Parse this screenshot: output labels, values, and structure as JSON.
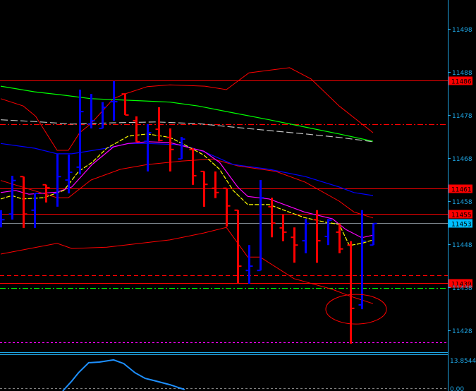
{
  "chart_data": [
    {
      "type": "bar",
      "subtype": "ohlc",
      "grid": false,
      "ylim": [
        11421,
        11505
      ],
      "y_ticks": [
        "11498",
        "11488",
        "11478",
        "11468",
        "11458",
        "11448",
        "11438",
        "11428"
      ],
      "colors": {
        "up": "#0000ff",
        "down": "#ff0000",
        "background": "#000000",
        "axis": "#1ea7e6"
      },
      "bars": [
        {
          "o": 11452.9,
          "h": 11455.9,
          "l": 11451.9,
          "c": 11453.7
        },
        {
          "o": 11455.0,
          "h": 11463.9,
          "l": 11453.7,
          "c": 11462.8
        },
        {
          "o": 11463.7,
          "h": 11463.7,
          "l": 11451.8,
          "c": 11455.0
        },
        {
          "o": 11455.9,
          "h": 11459.8,
          "l": 11451.8,
          "c": 11459.8
        },
        {
          "o": 11461.8,
          "h": 11461.8,
          "l": 11457.7,
          "c": 11461.1
        },
        {
          "o": 11459.8,
          "h": 11469.0,
          "l": 11456.7,
          "c": 11463.7
        },
        {
          "o": 11462.9,
          "h": 11468.8,
          "l": 11459.8,
          "c": 11464.7
        },
        {
          "o": 11465.9,
          "h": 11483.9,
          "l": 11464.2,
          "c": 11478.8
        },
        {
          "o": 11475.9,
          "h": 11482.9,
          "l": 11474.9,
          "c": 11476.7
        },
        {
          "o": 11474.9,
          "h": 11481.0,
          "l": 11474.9,
          "c": 11479.8
        },
        {
          "o": 11481.1,
          "h": 11485.9,
          "l": 11476.7,
          "c": 11481.1
        },
        {
          "o": 11482.9,
          "h": 11482.9,
          "l": 11478.0,
          "c": 11478.0
        },
        {
          "o": 11476.7,
          "h": 11477.7,
          "l": 11471.8,
          "c": 11471.8
        },
        {
          "o": 11471.9,
          "h": 11475.9,
          "l": 11464.9,
          "c": 11473.9
        },
        {
          "o": 11474.7,
          "h": 11479.8,
          "l": 11471.9,
          "c": 11472.1
        },
        {
          "o": 11472.8,
          "h": 11474.9,
          "l": 11464.9,
          "c": 11470.0
        },
        {
          "o": 11467.8,
          "h": 11472.9,
          "l": 11467.8,
          "c": 11472.4
        },
        {
          "o": 11470.0,
          "h": 11470.3,
          "l": 11461.8,
          "c": 11463.9
        },
        {
          "o": 11464.9,
          "h": 11464.9,
          "l": 11456.7,
          "c": 11461.9
        },
        {
          "o": 11461.0,
          "h": 11464.9,
          "l": 11458.7,
          "c": 11460.0
        },
        {
          "o": 11461.0,
          "h": 11461.0,
          "l": 11452.1,
          "c": 11456.9
        },
        {
          "o": 11455.9,
          "h": 11455.9,
          "l": 11438.8,
          "c": 11442.9
        },
        {
          "o": 11441.9,
          "h": 11447.8,
          "l": 11438.8,
          "c": 11442.9
        },
        {
          "o": 11441.9,
          "h": 11462.9,
          "l": 11441.9,
          "c": 11458.8
        },
        {
          "o": 11456.7,
          "h": 11458.8,
          "l": 11449.6,
          "c": 11452.9
        },
        {
          "o": 11451.8,
          "h": 11454.9,
          "l": 11448.7,
          "c": 11450.8
        },
        {
          "o": 11449.6,
          "h": 11451.9,
          "l": 11443.7,
          "c": 11447.8
        },
        {
          "o": 11448.8,
          "h": 11453.9,
          "l": 11445.9,
          "c": 11452.8
        },
        {
          "o": 11453.7,
          "h": 11455.9,
          "l": 11443.7,
          "c": 11448.8
        },
        {
          "o": 11449.8,
          "h": 11453.9,
          "l": 11447.8,
          "c": 11453.6
        },
        {
          "o": 11450.8,
          "h": 11452.8,
          "l": 11445.9,
          "c": 11446.9
        },
        {
          "o": 11447.8,
          "h": 11448.7,
          "l": 11424.9,
          "c": 11433.1
        },
        {
          "o": 11433.9,
          "h": 11455.9,
          "l": 11432.9,
          "c": 11448.7
        },
        {
          "o": 11447.8,
          "h": 11452.8,
          "l": 11447.8,
          "c": 11452.8
        }
      ],
      "lines": [
        {
          "color": "#ff0000",
          "style": "thin",
          "points": [
            [
              0,
              11481.8
            ],
            [
              2,
              11480.1
            ],
            [
              3.1,
              11477.7
            ],
            [
              5,
              11469.8
            ],
            [
              6,
              11469.8
            ],
            [
              7,
              11473.9
            ],
            [
              8,
              11476.0
            ],
            [
              10,
              11481.8
            ],
            [
              11,
              11482.9
            ],
            [
              13,
              11484.6
            ],
            [
              15,
              11485.0
            ],
            [
              18.1,
              11484.7
            ],
            [
              20,
              11483.9
            ],
            [
              22,
              11487.8
            ],
            [
              25.6,
              11489.0
            ],
            [
              27.5,
              11486.4
            ],
            [
              30,
              11480.1
            ],
            [
              33,
              11473.9
            ]
          ]
        },
        {
          "color": "#ff0000",
          "style": "thin",
          "points": [
            [
              0,
              11462.8
            ],
            [
              4,
              11459.6
            ],
            [
              5,
              11458.8
            ],
            [
              6,
              11458.8
            ],
            [
              8,
              11462.9
            ],
            [
              10.6,
              11465.4
            ],
            [
              13,
              11466.5
            ],
            [
              16,
              11467.3
            ],
            [
              18.8,
              11467.8
            ],
            [
              21,
              11466.2
            ],
            [
              24.4,
              11464.9
            ],
            [
              27,
              11462.4
            ],
            [
              30,
              11458.0
            ],
            [
              31.3,
              11455.5
            ],
            [
              33,
              11454.1
            ]
          ]
        },
        {
          "color": "#ff0000",
          "style": "thin",
          "points": [
            [
              0,
              11445.7
            ],
            [
              5,
              11448.2
            ],
            [
              6.3,
              11447.0
            ],
            [
              9.4,
              11447.3
            ],
            [
              15,
              11449.0
            ],
            [
              18,
              11450.6
            ],
            [
              20,
              11451.9
            ],
            [
              21.9,
              11445.0
            ],
            [
              23,
              11445.0
            ],
            [
              26,
              11440.0
            ],
            [
              29.4,
              11437.5
            ],
            [
              31,
              11435.9
            ],
            [
              33,
              11434.2
            ]
          ]
        },
        {
          "color": "#0000ff",
          "style": "solid",
          "points": [
            [
              0,
              11471.4
            ],
            [
              3,
              11470.3
            ],
            [
              5,
              11469.0
            ],
            [
              6.3,
              11469.0
            ],
            [
              9.4,
              11470.3
            ],
            [
              11.3,
              11471.4
            ],
            [
              13,
              11471.4
            ],
            [
              16,
              11471.1
            ],
            [
              18,
              11469.5
            ],
            [
              20.6,
              11466.5
            ],
            [
              23.8,
              11465.4
            ],
            [
              27,
              11463.7
            ],
            [
              30,
              11461.3
            ],
            [
              31.3,
              11460.0
            ],
            [
              33,
              11459.3
            ]
          ]
        },
        {
          "color": "#00ff00",
          "style": "solid",
          "points": [
            [
              0,
              11484.7
            ],
            [
              3,
              11483.4
            ],
            [
              5.6,
              11482.6
            ],
            [
              8,
              11481.8
            ],
            [
              12.5,
              11481.3
            ],
            [
              15,
              11481.0
            ],
            [
              17.5,
              11480.1
            ],
            [
              20.6,
              11478.5
            ],
            [
              23.8,
              11476.9
            ],
            [
              27,
              11475.2
            ],
            [
              30,
              11473.6
            ],
            [
              33,
              11471.9
            ]
          ]
        },
        {
          "color": "#c0c0c0",
          "style": "dashed",
          "points": [
            [
              0,
              11476.9
            ],
            [
              3,
              11476.5
            ],
            [
              6.3,
              11475.9
            ],
            [
              10,
              11476.2
            ],
            [
              13.8,
              11476.4
            ],
            [
              17.5,
              11476.0
            ],
            [
              20.6,
              11475.2
            ],
            [
              23.8,
              11474.4
            ],
            [
              27,
              11473.6
            ],
            [
              30,
              11472.8
            ],
            [
              33,
              11471.8
            ]
          ]
        },
        {
          "color": "#ff00ff",
          "style": "solid",
          "points": [
            [
              0,
              11460.0
            ],
            [
              1.3,
              11460.5
            ],
            [
              2.5,
              11459.6
            ],
            [
              5,
              11460.1
            ],
            [
              6.3,
              11461.3
            ],
            [
              8.1,
              11466.5
            ],
            [
              10,
              11470.6
            ],
            [
              11.3,
              11471.4
            ],
            [
              13,
              11471.8
            ],
            [
              15,
              11471.6
            ],
            [
              16.9,
              11470.3
            ],
            [
              18,
              11469.6
            ],
            [
              19.4,
              11467.0
            ],
            [
              21,
              11461.3
            ],
            [
              21.9,
              11459.1
            ],
            [
              23.8,
              11458.5
            ],
            [
              26.9,
              11455.5
            ],
            [
              29.4,
              11453.9
            ],
            [
              30.6,
              11451.4
            ],
            [
              32,
              11449.5
            ],
            [
              33,
              11450.1
            ]
          ]
        },
        {
          "color": "#ffff00",
          "style": "dotted",
          "points": [
            [
              0,
              11458.5
            ],
            [
              1,
              11459.3
            ],
            [
              1.9,
              11458.5
            ],
            [
              3.8,
              11458.8
            ],
            [
              5.6,
              11460.5
            ],
            [
              6.9,
              11464.9
            ],
            [
              8.1,
              11467.0
            ],
            [
              9.4,
              11470.3
            ],
            [
              11.3,
              11473.1
            ],
            [
              13,
              11473.6
            ],
            [
              15,
              11472.8
            ],
            [
              16.3,
              11471.1
            ],
            [
              18,
              11468.7
            ],
            [
              19.4,
              11465.4
            ],
            [
              20.6,
              11460.5
            ],
            [
              21.9,
              11457.2
            ],
            [
              23.8,
              11457.2
            ],
            [
              25,
              11456.0
            ],
            [
              26.9,
              11454.2
            ],
            [
              28.8,
              11453.1
            ],
            [
              30,
              11452.6
            ],
            [
              30.9,
              11447.7
            ],
            [
              32,
              11448.2
            ],
            [
              33,
              11449.0
            ]
          ]
        }
      ],
      "levels": [
        {
          "price": 11486,
          "label": "11486",
          "color": "#ff0000",
          "style": "solid",
          "tag": true
        },
        {
          "price": 11461,
          "label": "11461",
          "color": "#ff0000",
          "style": "solid",
          "tag": true
        },
        {
          "price": 11455,
          "label": "11455",
          "color": "#ff0000",
          "style": "solid",
          "tag": true
        },
        {
          "price": 11453,
          "label": "11453",
          "color": "#808890",
          "style": "solid",
          "tag": true,
          "tag_color": "#00bfff"
        },
        {
          "price": 11439,
          "label": "11439",
          "color": "#ff0000",
          "style": "solid",
          "tag": true
        },
        {
          "price": 11475.9,
          "color": "#ff0000",
          "style": "dashdot",
          "tag": false
        },
        {
          "price": 11440.8,
          "color": "#ff0000",
          "style": "dashed",
          "tag": false
        },
        {
          "price": 11437.8,
          "color": "#00ff00",
          "style": "dashdot",
          "tag": false
        },
        {
          "price": 11425.2,
          "color": "#ff00ff",
          "style": "dotted",
          "tag": false
        }
      ],
      "annotation": {
        "type": "ellipse",
        "color": "#ff0000",
        "center": [
          31.5,
          11432.9
        ]
      }
    },
    {
      "type": "line",
      "panel": "indicator",
      "grid": false,
      "ylim": [
        0,
        13.8544
      ],
      "y_ticks": [
        "13.8544",
        "0.00"
      ],
      "series": [
        {
          "color": "#1e90ff",
          "points": [
            [
              5.5,
              -1.4
            ],
            [
              6.3,
              3.5
            ],
            [
              6.9,
              7.6
            ],
            [
              7.8,
              12.5
            ],
            [
              8.75,
              12.8
            ],
            [
              10,
              13.9
            ],
            [
              10.9,
              12.1
            ],
            [
              11.9,
              7.6
            ],
            [
              12.8,
              4.8
            ],
            [
              13.75,
              3.5
            ],
            [
              15,
              1.7
            ],
            [
              16.3,
              -0.7
            ]
          ]
        }
      ]
    }
  ]
}
